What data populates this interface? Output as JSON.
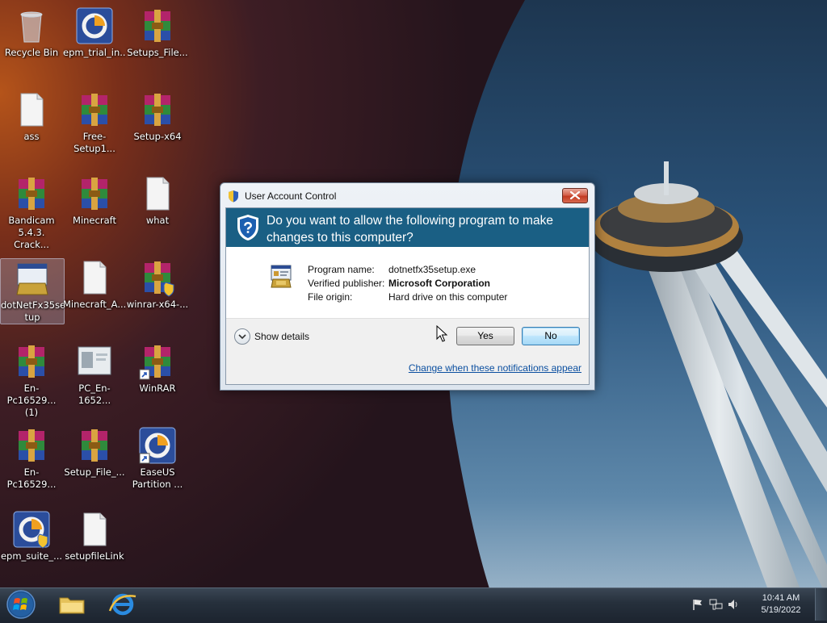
{
  "desktop": {
    "icons": [
      {
        "id": "recycle-bin",
        "label": "Recycle Bin",
        "kind": "recycle"
      },
      {
        "id": "epm-trial",
        "label": "epm_trial_in...",
        "kind": "epm"
      },
      {
        "id": "setups-file",
        "label": "Setups_File...",
        "kind": "rar"
      },
      {
        "id": "ass",
        "label": "ass",
        "kind": "doc"
      },
      {
        "id": "free-setup",
        "label": "Free-Setup1...",
        "kind": "rar"
      },
      {
        "id": "setup-x64",
        "label": "Setup-x64",
        "kind": "rar"
      },
      {
        "id": "bandicam",
        "label": "Bandicam\n5.4.3. Crack...",
        "kind": "rar"
      },
      {
        "id": "minecraft",
        "label": "Minecraft",
        "kind": "rar"
      },
      {
        "id": "what",
        "label": "what",
        "kind": "doc"
      },
      {
        "id": "dotnetfx35setup",
        "label": "dotNetFx35se\ntup",
        "kind": "setup"
      },
      {
        "id": "minecraft-a",
        "label": "Minecraft_A...",
        "kind": "doc"
      },
      {
        "id": "winrar-x64",
        "label": "winrar-x64-...",
        "kind": "rar-shield"
      },
      {
        "id": "en-pc-1",
        "label": "En-Pc16529...\n(1)",
        "kind": "rar"
      },
      {
        "id": "pc-en",
        "label": "PC_En-1652...",
        "kind": "window"
      },
      {
        "id": "winrar",
        "label": "WinRAR",
        "kind": "rar-shortcut"
      },
      {
        "id": "en-pc-2",
        "label": "En-Pc16529...",
        "kind": "rar"
      },
      {
        "id": "setup-file",
        "label": "Setup_File_...",
        "kind": "rar"
      },
      {
        "id": "easeus",
        "label": "EaseUS\nPartition ...",
        "kind": "epm-shortcut"
      },
      {
        "id": "epm-suite",
        "label": "epm_suite_...",
        "kind": "epm-shield"
      },
      {
        "id": "setupfilelink",
        "label": "setupfileLink",
        "kind": "doc"
      }
    ]
  },
  "dialog": {
    "title": "User Account Control",
    "question": "Do you want to allow the following program to make changes to this computer?",
    "fields": [
      {
        "key": "Program name:",
        "value": "dotnetfx35setup.exe",
        "bold": false
      },
      {
        "key": "Verified publisher:",
        "value": "Microsoft Corporation",
        "bold": true
      },
      {
        "key": "File origin:",
        "value": "Hard drive on this computer",
        "bold": false
      }
    ],
    "show_details": "Show details",
    "yes": "Yes",
    "no": "No",
    "change_link": "Change when these notifications appear",
    "banner_color": "#1a5f84"
  },
  "taskbar": {
    "time": "10:41 AM",
    "date": "5/19/2022"
  }
}
